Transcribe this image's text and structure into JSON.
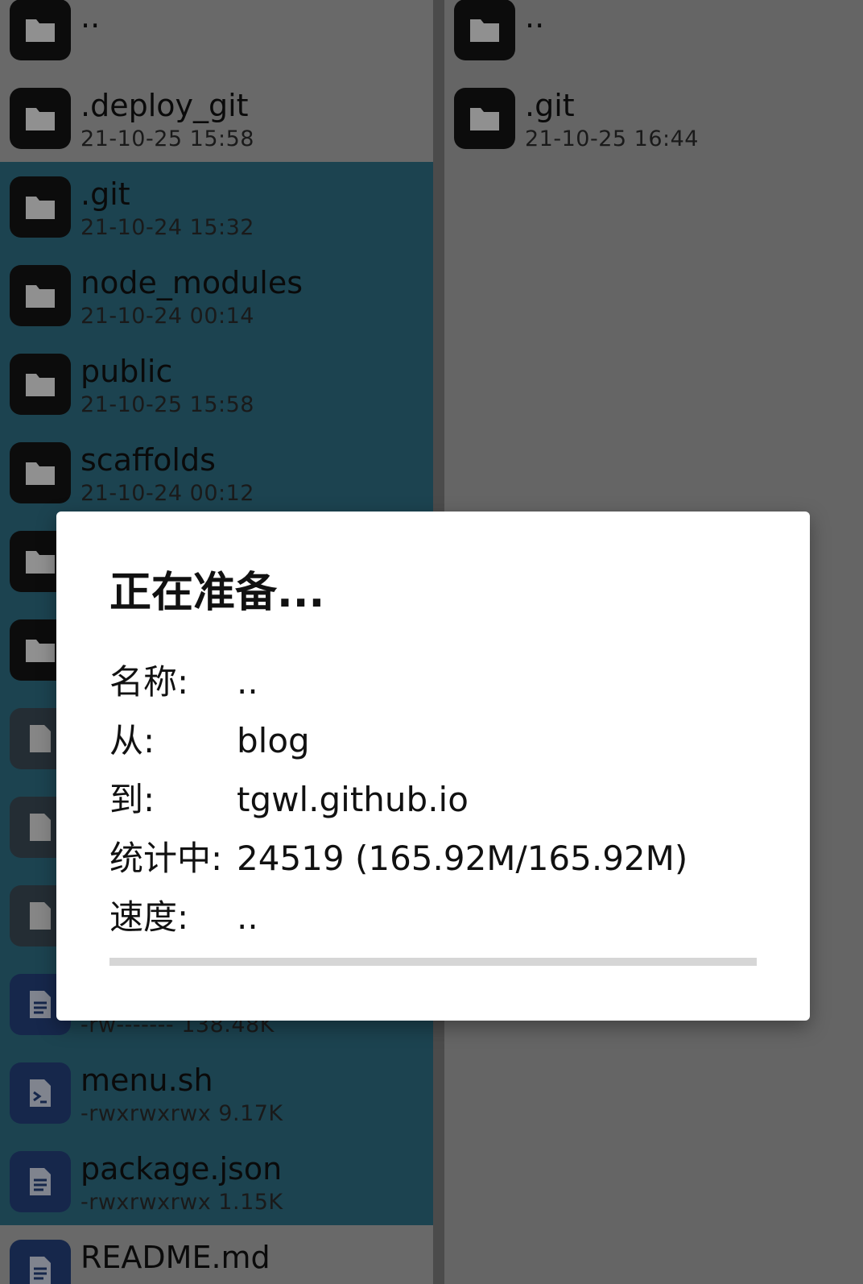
{
  "left_pane": {
    "items": [
      {
        "name": "..",
        "meta": "",
        "type": "folder"
      },
      {
        "name": ".deploy_git",
        "meta": "21-10-25 15:58",
        "type": "folder"
      },
      {
        "name": ".git",
        "meta": "21-10-24 15:32",
        "type": "folder",
        "selected": true
      },
      {
        "name": "node_modules",
        "meta": "21-10-24 00:14",
        "type": "folder",
        "selected": true
      },
      {
        "name": "public",
        "meta": "21-10-25 15:58",
        "type": "folder",
        "selected": true
      },
      {
        "name": "scaffolds",
        "meta": "21-10-24 00:12",
        "type": "folder",
        "selected": true
      },
      {
        "name": "",
        "meta": "",
        "type": "folder",
        "selected": true
      },
      {
        "name": "",
        "meta": "",
        "type": "folder",
        "selected": true
      },
      {
        "name": "",
        "meta": "",
        "type": "file",
        "selected": true
      },
      {
        "name": "",
        "meta": "",
        "type": "file",
        "selected": true
      },
      {
        "name": "",
        "meta": "",
        "type": "file",
        "selected": true
      },
      {
        "name": "",
        "meta": "-rw------- 138.48K",
        "type": "doc",
        "selected": true
      },
      {
        "name": "menu.sh",
        "meta": "-rwxrwxrwx 9.17K",
        "type": "script",
        "selected": true
      },
      {
        "name": "package.json",
        "meta": "-rwxrwxrwx 1.15K",
        "type": "doc",
        "selected": true
      },
      {
        "name": "README.md",
        "meta": "",
        "type": "doc"
      }
    ]
  },
  "right_pane": {
    "items": [
      {
        "name": "..",
        "meta": "",
        "type": "folder"
      },
      {
        "name": ".git",
        "meta": "21-10-25 16:44",
        "type": "folder"
      }
    ]
  },
  "dialog": {
    "title": "正在准备...",
    "fields": [
      {
        "label": "名称:",
        "value": ".."
      },
      {
        "label": "从:",
        "value": "blog"
      },
      {
        "label": "到:",
        "value": "tgwl.github.io"
      },
      {
        "label": "统计中:",
        "value": "24519 (165.92M/165.92M)"
      },
      {
        "label": "速度:",
        "value": ".."
      }
    ],
    "progress": 0
  }
}
